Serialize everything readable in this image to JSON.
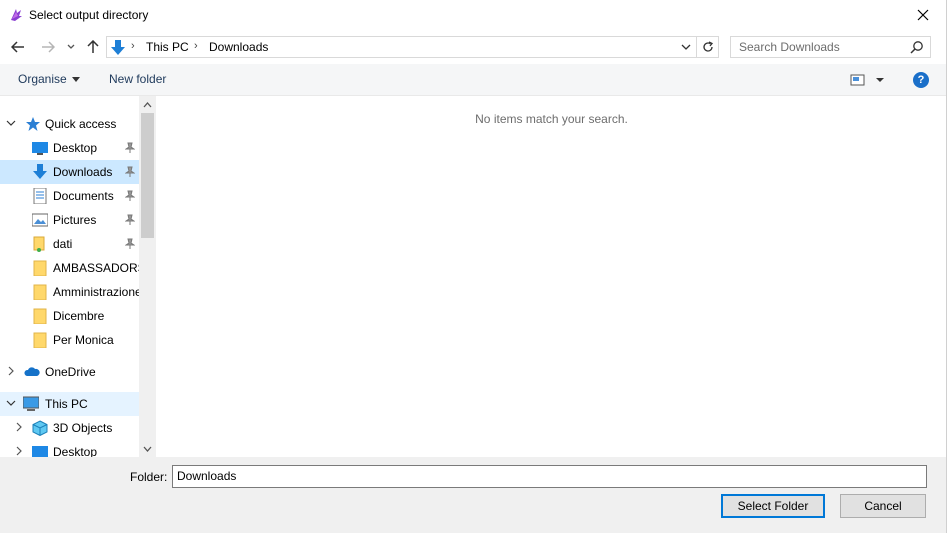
{
  "window": {
    "title": "Select output directory",
    "close_icon": "close-icon"
  },
  "address": {
    "location_icon": "downloads-arrow-icon",
    "breadcrumbs": [
      "This PC",
      "Downloads"
    ],
    "separator": "›"
  },
  "search": {
    "placeholder": "Search Downloads"
  },
  "toolbar": {
    "organise": "Organise",
    "new_folder": "New folder",
    "help": "?"
  },
  "nav_pane": {
    "items": [
      {
        "label": "Quick access",
        "icon": "star-icon",
        "expanded": true
      },
      {
        "label": "Desktop",
        "icon": "desktop-icon",
        "pinned": true
      },
      {
        "label": "Downloads",
        "icon": "downloads-icon",
        "pinned": true,
        "selected": true
      },
      {
        "label": "Documents",
        "icon": "documents-icon",
        "pinned": true
      },
      {
        "label": "Pictures",
        "icon": "pictures-icon",
        "pinned": true
      },
      {
        "label": "dati",
        "icon": "user-folder-icon",
        "pinned": true
      },
      {
        "label": "AMBASSADORS",
        "icon": "folder-icon"
      },
      {
        "label": "Amministrazione",
        "icon": "folder-icon"
      },
      {
        "label": "Dicembre",
        "icon": "folder-icon"
      },
      {
        "label": "Per Monica",
        "icon": "folder-icon"
      },
      {
        "label": "OneDrive",
        "icon": "onedrive-icon"
      },
      {
        "label": "This PC",
        "icon": "this-pc-icon",
        "expanded": true
      },
      {
        "label": "3D Objects",
        "icon": "3d-objects-icon"
      },
      {
        "label": "Desktop",
        "icon": "desktop-icon"
      }
    ]
  },
  "content": {
    "empty_message": "No items match your search."
  },
  "footer": {
    "folder_label": "Folder:",
    "folder_value": "Downloads",
    "select_button": "Select Folder",
    "cancel_button": "Cancel"
  },
  "colors": {
    "accent": "#0078d7",
    "selected_bg": "#cce8ff",
    "hover_bg": "#e5f3ff",
    "folder_yellow": "#ffd86b"
  }
}
